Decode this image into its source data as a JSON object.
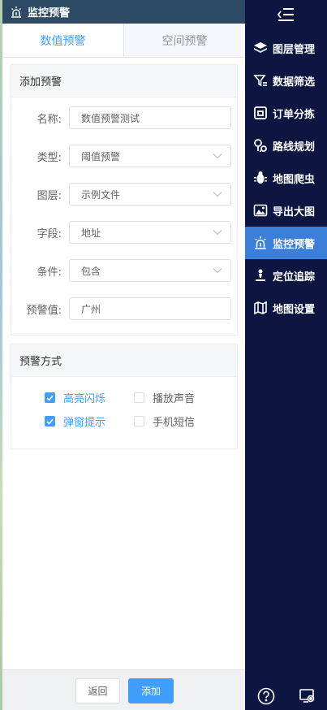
{
  "header": {
    "title": "监控预警"
  },
  "tabs": [
    {
      "label": "数值预警",
      "active": true
    },
    {
      "label": "空间预警",
      "active": false
    }
  ],
  "add_card": {
    "title": "添加预警",
    "fields": [
      {
        "label": "名称:",
        "value": "数值预警测试",
        "type": "input"
      },
      {
        "label": "类型:",
        "value": "阈值预警",
        "type": "select"
      },
      {
        "label": "图层:",
        "value": "示例文件",
        "type": "select"
      },
      {
        "label": "字段:",
        "value": "地址",
        "type": "select"
      },
      {
        "label": "条件:",
        "value": "包含",
        "type": "select"
      },
      {
        "label": "预警值:",
        "value": "广州",
        "type": "input"
      }
    ]
  },
  "method_card": {
    "title": "预警方式",
    "options": [
      {
        "label": "高亮闪烁",
        "checked": true
      },
      {
        "label": "播放声音",
        "checked": false
      },
      {
        "label": "弹窗提示",
        "checked": true
      },
      {
        "label": "手机短信",
        "checked": false
      }
    ]
  },
  "footer": {
    "back_label": "返回",
    "add_label": "添加"
  },
  "sidebar": {
    "items": [
      {
        "label": "图层管理",
        "icon": "layers-icon",
        "active": false
      },
      {
        "label": "数据筛选",
        "icon": "filter-icon",
        "active": false
      },
      {
        "label": "订单分拣",
        "icon": "order-icon",
        "active": false
      },
      {
        "label": "路线规划",
        "icon": "route-icon",
        "active": false
      },
      {
        "label": "地图爬虫",
        "icon": "bug-icon",
        "active": false
      },
      {
        "label": "导出大图",
        "icon": "image-export-icon",
        "active": false
      },
      {
        "label": "监控预警",
        "icon": "monitor-alert-icon",
        "active": true
      },
      {
        "label": "定位追踪",
        "icon": "location-track-icon",
        "active": false
      },
      {
        "label": "地图设置",
        "icon": "map-settings-icon",
        "active": false
      }
    ]
  },
  "colors": {
    "accent": "#409eff",
    "sidebar_bg": "#0c1640",
    "sidebar_active": "#3c7fd8",
    "header_bg": "#2d4a64"
  }
}
